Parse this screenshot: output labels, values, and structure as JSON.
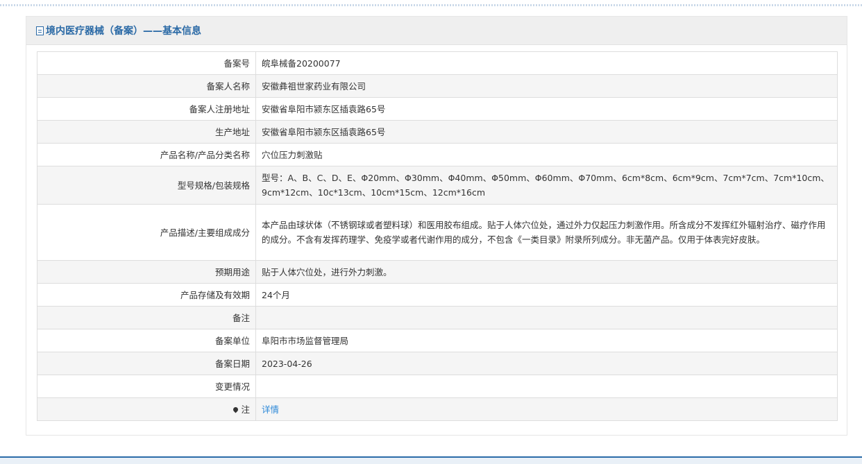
{
  "panel": {
    "title": "境内医疗器械（备案）——基本信息"
  },
  "rows": [
    {
      "label": "备案号",
      "value": "皖阜械备20200077"
    },
    {
      "label": "备案人名称",
      "value": "安徽彝祖世家药业有限公司"
    },
    {
      "label": "备案人注册地址",
      "value": "安徽省阜阳市颍东区插袁路65号"
    },
    {
      "label": "生产地址",
      "value": "安徽省阜阳市颍东区插袁路65号"
    },
    {
      "label": "产品名称/产品分类名称",
      "value": "穴位压力刺激贴"
    },
    {
      "label": "型号规格/包装规格",
      "value": "型号：A、B、C、D、E、Φ20mm、Φ30mm、Φ40mm、Φ50mm、Φ60mm、Φ70mm、6cm*8cm、6cm*9cm、7cm*7cm、7cm*10cm、9cm*12cm、10c*13cm、10cm*15cm、12cm*16cm"
    },
    {
      "label": "产品描述/主要组成成分",
      "value": "本产品由球状体（不锈钢球或者塑料球）和医用胶布组成。贴于人体穴位处，通过外力仅起压力刺激作用。所含成分不发挥红外辐射治疗、磁疗作用的成分。不含有发挥药理学、免疫学或者代谢作用的成分，不包含《一类目录》附录所列成分。非无菌产品。仅用于体表完好皮肤。"
    },
    {
      "label": "预期用途",
      "value": "贴于人体穴位处，进行外力刺激。"
    },
    {
      "label": "产品存储及有效期",
      "value": "24个月"
    },
    {
      "label": "备注",
      "value": ""
    },
    {
      "label": "备案单位",
      "value": "阜阳市市场监督管理局"
    },
    {
      "label": "备案日期",
      "value": "2023-04-26"
    },
    {
      "label": "变更情况",
      "value": ""
    },
    {
      "label": "注",
      "value": "详情",
      "icon": "map-pin-icon"
    }
  ]
}
